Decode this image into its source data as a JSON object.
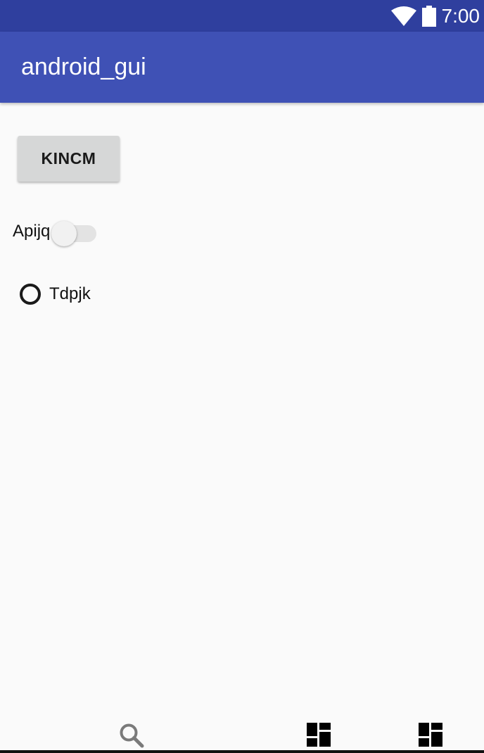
{
  "status_bar": {
    "time": "7:00",
    "icons": [
      "wifi-icon",
      "battery-icon"
    ],
    "background_color": "#2f3f9e"
  },
  "app_bar": {
    "title": "android_gui",
    "background_color": "#3f51b5"
  },
  "content": {
    "button_label": "KINCM",
    "switch": {
      "label": "Apijq",
      "checked": false
    },
    "radio": {
      "label": "Tdpjk",
      "selected": false
    }
  },
  "bottom_bar": {
    "icons": [
      "search-icon",
      "dashboard-icon",
      "dashboard-icon"
    ]
  }
}
